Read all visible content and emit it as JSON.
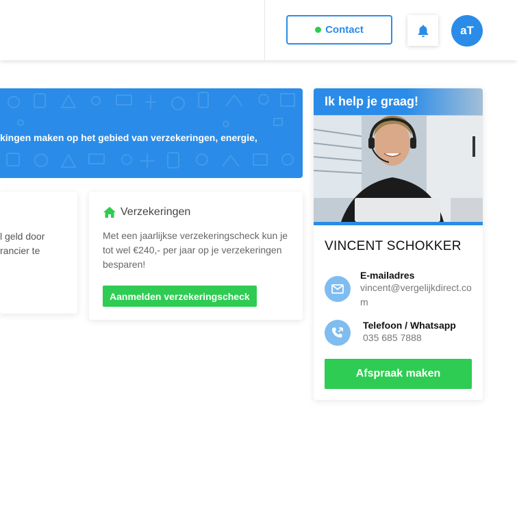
{
  "header": {
    "contact_label": "Contact",
    "avatar_initials": "aT"
  },
  "banner": {
    "text_normal": "kingen maken op het gebied van ",
    "text_bold": "verzekeringen, energie,"
  },
  "card_left": {
    "text": "l geld door\nrancier te"
  },
  "card_insurance": {
    "title": "Verzekeringen",
    "description": "Met een jaarlijkse verzekeringscheck kun je tot wel €240,- per jaar op je verzekeringen besparen!",
    "button_label": "Aanmelden verzekeringscheck"
  },
  "help": {
    "heading": "Ik help je graag!",
    "name": "VINCENT SCHOKKER",
    "email_label": "E-mailadres",
    "email_value": "vincent@vergelijkdirect.com",
    "phone_label": "Telefoon / Whatsapp",
    "phone_value": "035 685 7888",
    "button_label": "Afspraak maken"
  },
  "colors": {
    "primary": "#2a8ce8",
    "success": "#2ecc52",
    "icon_circle": "#7fbcf0"
  }
}
